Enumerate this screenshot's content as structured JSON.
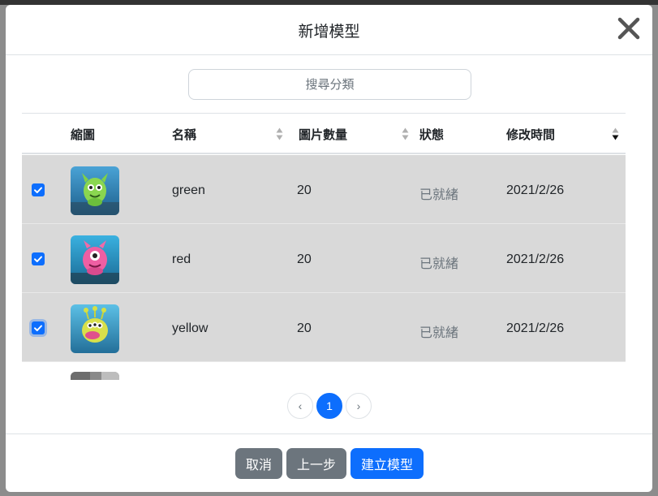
{
  "modal": {
    "title": "新增模型",
    "close_icon": "close-icon"
  },
  "search": {
    "placeholder": "搜尋分類",
    "value": ""
  },
  "table": {
    "columns": [
      "縮圖",
      "名稱",
      "圖片數量",
      "狀態",
      "修改時間"
    ],
    "sortable": {
      "名稱": "unsorted",
      "圖片數量": "unsorted",
      "修改時間": "descending"
    },
    "rows": [
      {
        "checked": true,
        "thumbnail": "green-monster-thumbnail",
        "name": "green",
        "count": "20",
        "status": "已就緒",
        "modified": "2021/2/26"
      },
      {
        "checked": true,
        "thumbnail": "red-monster-thumbnail",
        "name": "red",
        "count": "20",
        "status": "已就緒",
        "modified": "2021/2/26"
      },
      {
        "checked": true,
        "thumbnail": "yellow-monster-thumbnail",
        "name": "yellow",
        "count": "20",
        "status": "已就緒",
        "modified": "2021/2/26"
      }
    ],
    "selected_row_color": "#d9d9d9"
  },
  "pagination": {
    "prev": "‹",
    "current": "1",
    "next": "›"
  },
  "footer": {
    "cancel": "取消",
    "back": "上一步",
    "create": "建立模型"
  },
  "colors": {
    "primary": "#0d6efd",
    "secondary": "#6c757d"
  }
}
